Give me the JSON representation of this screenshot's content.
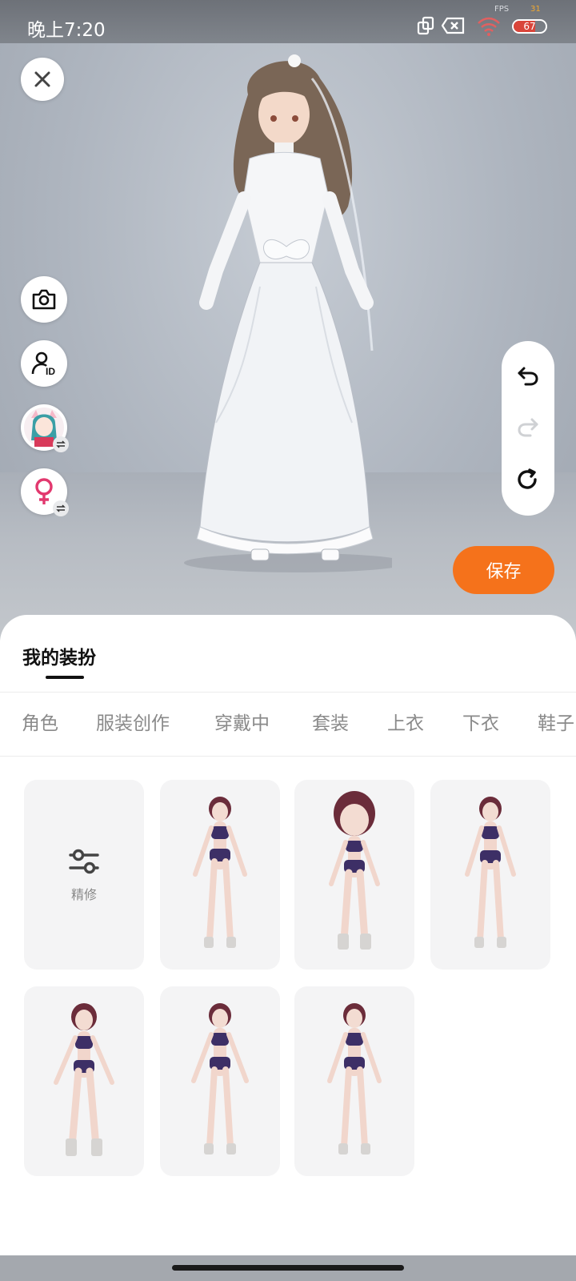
{
  "status_bar": {
    "time": "晚上7:20",
    "fps_label": "FPS",
    "fps_value": "31",
    "battery_level": 67,
    "icons": [
      "screen-rotate-icon",
      "sim-off-icon",
      "wifi-icon",
      "battery-icon"
    ]
  },
  "avatar_view": {
    "description": "3D avatar in white wedding dress",
    "close_icon": "close-icon",
    "side_tools": [
      "camera-icon",
      "avatar-id-icon",
      "avatar-switch",
      "gender-female-icon"
    ],
    "history_tools": [
      "undo-icon",
      "redo-icon",
      "reset-icon"
    ],
    "save_label": "保存"
  },
  "sheet": {
    "title": "我的装扮",
    "tabs": [
      "角色",
      "服装创作",
      "穿戴中",
      "套装",
      "上衣",
      "下衣",
      "鞋子"
    ],
    "refine_label": "精修",
    "outfit_items": 6
  },
  "colors": {
    "accent": "#f5721b",
    "tab_text": "#8a8a8a",
    "card_bg": "#f4f4f5"
  }
}
